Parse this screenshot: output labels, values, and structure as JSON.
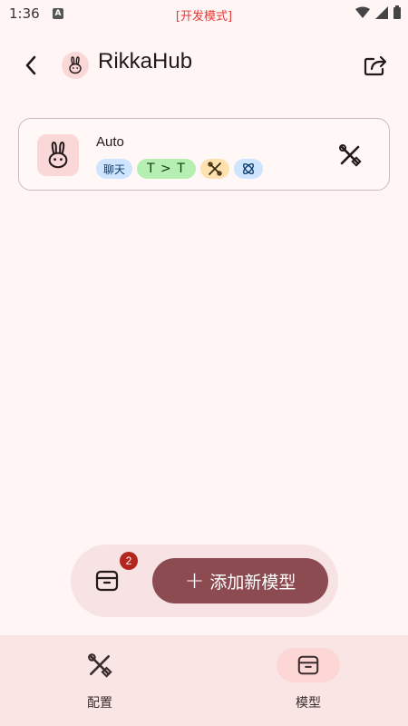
{
  "status_bar": {
    "time": "1:36",
    "dev_mode": "[开发模式]"
  },
  "header": {
    "title": "RikkaHub"
  },
  "model_card": {
    "name": "Auto",
    "tags": {
      "chat": "聊天",
      "modality": "T > T"
    }
  },
  "fab": {
    "badge_count": "2",
    "add_label": "添加新模型"
  },
  "bottom_nav": {
    "items": [
      {
        "label": "配置",
        "icon": "tools-icon"
      },
      {
        "label": "模型",
        "icon": "box-icon",
        "selected": true
      }
    ]
  },
  "colors": {
    "background": "#fff5f4",
    "primary_button": "#8c4a51",
    "badge": "#b3261e",
    "nav_selected": "#fdd6d6",
    "tag_chat": "#cfe4ff",
    "tag_modality": "#b6efb2",
    "tag_tool": "#ffe1b0"
  }
}
